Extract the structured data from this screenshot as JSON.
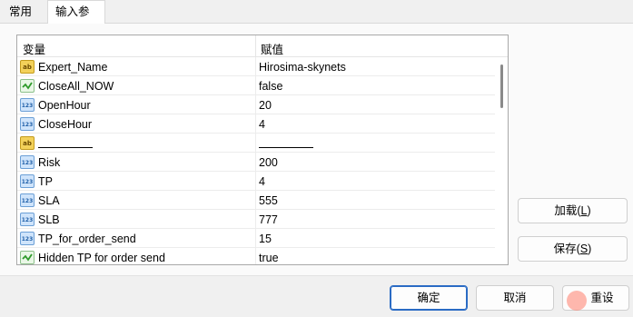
{
  "tabs": [
    {
      "label": "常用"
    },
    {
      "label": "输入参数"
    }
  ],
  "table": {
    "col_variable": "变量",
    "col_value": "赋值",
    "rows": [
      {
        "type": "string",
        "name": "Expert_Name",
        "value": "Hirosima-skynets"
      },
      {
        "type": "bool",
        "name": "CloseAll_NOW",
        "value": "false"
      },
      {
        "type": "int",
        "name": "OpenHour",
        "value": "20"
      },
      {
        "type": "int",
        "name": "CloseHour",
        "value": "4"
      },
      {
        "type": "string",
        "name": "",
        "value": ""
      },
      {
        "type": "int",
        "name": "Risk",
        "value": "200"
      },
      {
        "type": "int",
        "name": "TP",
        "value": "4"
      },
      {
        "type": "int",
        "name": "SLA",
        "value": "555"
      },
      {
        "type": "int",
        "name": "SLB",
        "value": "777"
      },
      {
        "type": "int",
        "name": "TP_for_order_send",
        "value": "15"
      },
      {
        "type": "bool",
        "name": "Hidden TP for order send",
        "value": "true"
      }
    ]
  },
  "buttons": {
    "load_label": "加载(",
    "load_key": "L",
    "save_label": "保存(",
    "save_key": "S",
    "ok_label": "确定",
    "cancel_label": "取消",
    "reset_label": "重设",
    "close_paren": ")"
  },
  "icons": {
    "string": "ab",
    "int": "123",
    "bool": "check"
  }
}
